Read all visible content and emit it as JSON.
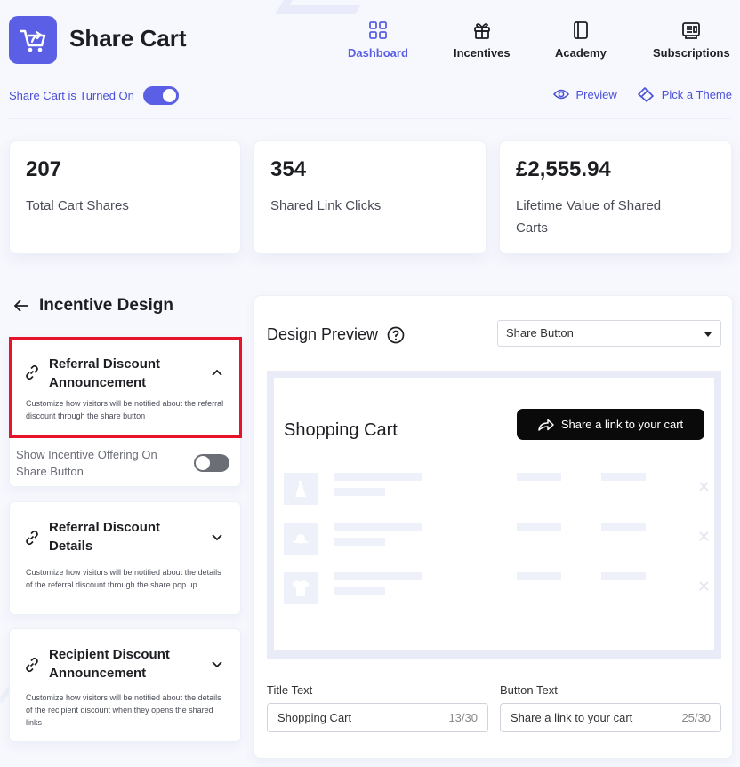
{
  "app": {
    "title": "Share Cart",
    "brand_color": "#5a5fe6"
  },
  "nav": [
    {
      "label": "Dashboard",
      "icon": "grid-icon",
      "active": true
    },
    {
      "label": "Incentives",
      "icon": "gift-icon",
      "active": false
    },
    {
      "label": "Academy",
      "icon": "book-icon",
      "active": false
    },
    {
      "label": "Subscriptions",
      "icon": "receipt-icon",
      "active": false
    }
  ],
  "status_toggle": {
    "label": "Share Cart is Turned On",
    "on": true
  },
  "top_actions": {
    "preview": "Preview",
    "theme": "Pick a Theme"
  },
  "stats": [
    {
      "value": "207",
      "label": "Total Cart Shares"
    },
    {
      "value": "354",
      "label": "Shared Link Clicks"
    },
    {
      "value": "£2,555.94",
      "label": "Lifetime Value of Shared Carts"
    }
  ],
  "incentive_design": {
    "title": "Incentive Design",
    "sections": [
      {
        "title": "Referral Discount Announcement",
        "desc": "Customize how visitors will be notified about the referral discount through the share button",
        "expanded": true
      },
      {
        "title": "Referral Discount Details",
        "desc": "Customize how visitors will be notified about the details of the referral discount through the share pop up",
        "expanded": false
      },
      {
        "title": "Recipient Discount Announcement",
        "desc": "Customize how visitors will be notified about the details of the recipient discount when they opens the shared links",
        "expanded": false
      }
    ],
    "show_incentive_label": "Show Incentive Offering On Share Button",
    "show_incentive_on": false
  },
  "preview": {
    "title": "Design Preview",
    "select_value": "Share Button",
    "mock_title": "Shopping Cart",
    "mock_button": "Share a link to your cart",
    "title_text_label": "Title Text",
    "title_text_value": "Shopping Cart",
    "title_text_count": "13/30",
    "button_text_label": "Button Text",
    "button_text_value": "Share a link to your cart",
    "button_text_count": "25/30"
  }
}
